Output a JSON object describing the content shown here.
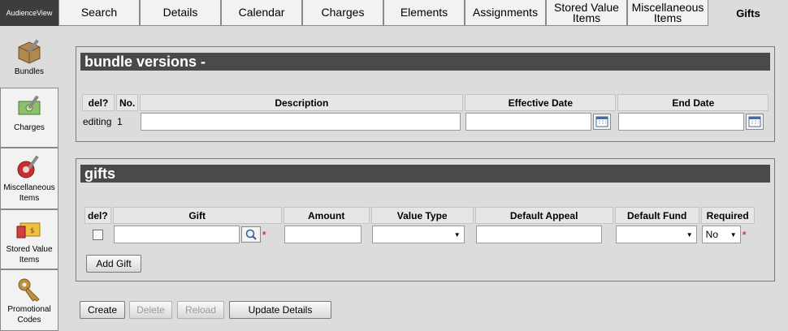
{
  "app": {
    "brand": "AudienceView"
  },
  "tabs": [
    {
      "label": "Search"
    },
    {
      "label": "Details"
    },
    {
      "label": "Calendar"
    },
    {
      "label": "Charges"
    },
    {
      "label": "Elements"
    },
    {
      "label": "Assignments"
    },
    {
      "label": "Stored Value Items"
    },
    {
      "label": "Miscellaneous Items"
    },
    {
      "label": "Gifts",
      "active": true
    }
  ],
  "sidebar": {
    "items": [
      {
        "label": "Bundles",
        "icon": "bundles-icon",
        "active": true
      },
      {
        "label": "Charges",
        "icon": "charges-icon"
      },
      {
        "label": "Miscellaneous Items",
        "icon": "miscellaneous-items-icon"
      },
      {
        "label": "Stored Value Items",
        "icon": "stored-value-items-icon"
      },
      {
        "label": "Promotional Codes",
        "icon": "promotional-codes-icon"
      }
    ]
  },
  "versions": {
    "title": "bundle versions -",
    "columns": {
      "del": "del?",
      "no": "No.",
      "description": "Description",
      "effective_date": "Effective Date",
      "end_date": "End Date"
    },
    "row": {
      "del": "editing",
      "no": "1",
      "description": "",
      "effective_date": "",
      "end_date": ""
    }
  },
  "gifts": {
    "title": "gifts",
    "columns": {
      "del": "del?",
      "gift": "Gift",
      "amount": "Amount",
      "value_type": "Value Type",
      "default_appeal": "Default Appeal",
      "default_fund": "Default Fund",
      "required": "Required"
    },
    "row": {
      "gift": "",
      "amount": "",
      "value_type": "",
      "default_appeal": "",
      "default_fund": "",
      "required": "No"
    },
    "required_marker": "*",
    "add_button": "Add Gift"
  },
  "actions": {
    "create": "Create",
    "delete": "Delete",
    "reload": "Reload",
    "update": "Update Details"
  },
  "colors": {
    "header_bar": "#4a4a4a",
    "brand_bg": "#3d3d3d",
    "background": "#dcdcdc",
    "required": "#d00000"
  }
}
